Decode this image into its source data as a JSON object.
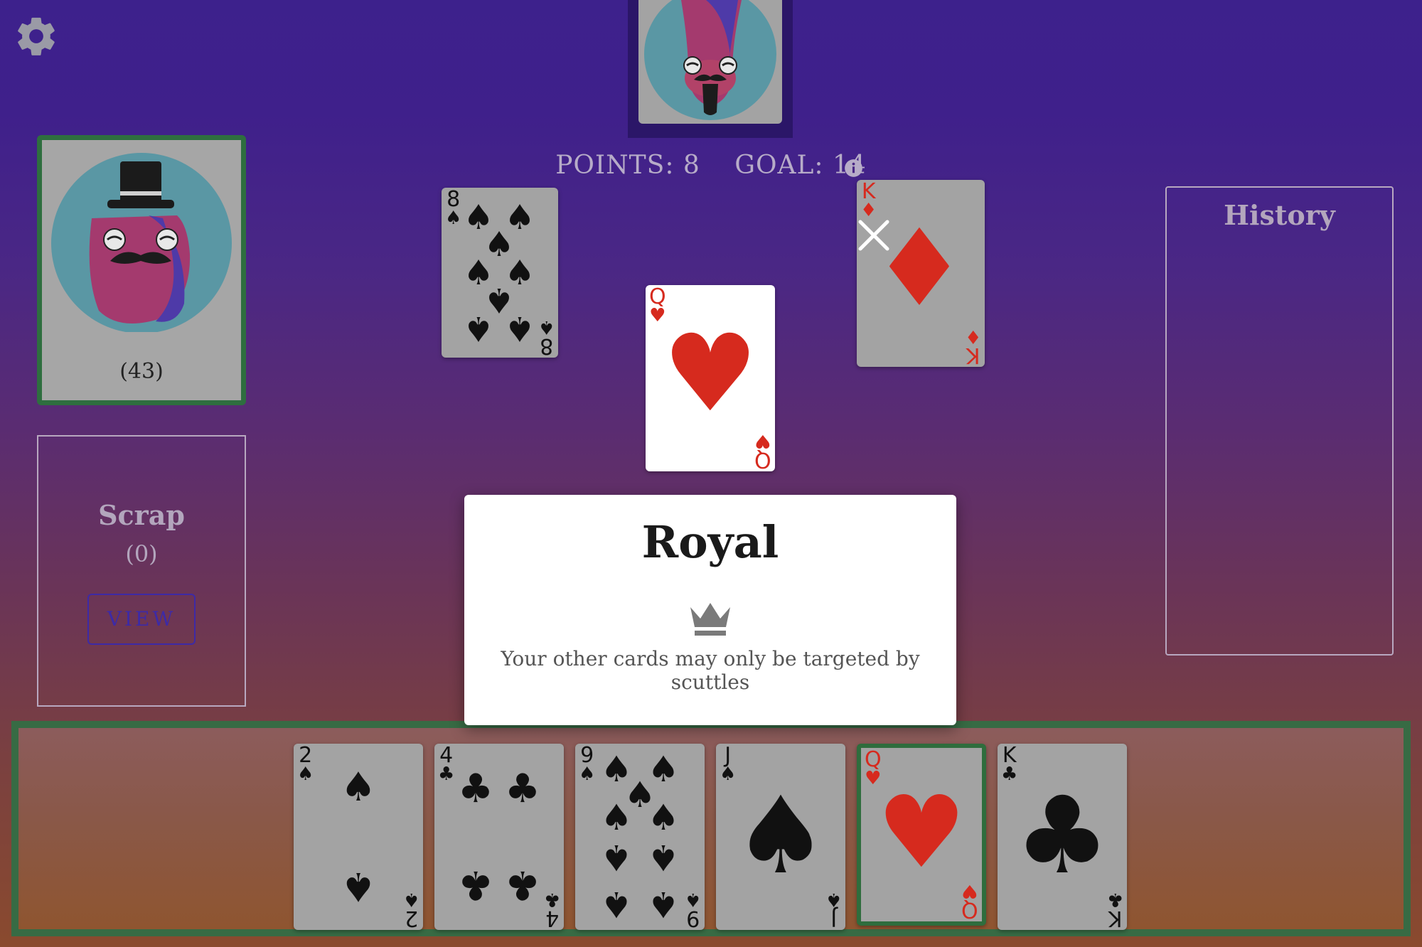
{
  "scoreboard": {
    "points_label": "POINTS: 8",
    "goal_label": "GOAL: 14"
  },
  "deck": {
    "count_label": "(43)"
  },
  "scrap": {
    "title": "Scrap",
    "count_label": "(0)",
    "view_label": "VIEW"
  },
  "history": {
    "title": "History"
  },
  "board": {
    "cards": [
      {
        "rank": "8",
        "suit": "♠",
        "color": "black"
      },
      {
        "rank": "Q",
        "suit": "♥",
        "color": "red"
      },
      {
        "rank": "K",
        "suit": "♦",
        "color": "red"
      }
    ]
  },
  "hand": {
    "cards": [
      {
        "rank": "2",
        "suit": "♠",
        "color": "black"
      },
      {
        "rank": "4",
        "suit": "♣",
        "color": "black"
      },
      {
        "rank": "9",
        "suit": "♠",
        "color": "black"
      },
      {
        "rank": "J",
        "suit": "♠",
        "color": "black"
      },
      {
        "rank": "Q",
        "suit": "♥",
        "color": "red",
        "selected": true
      },
      {
        "rank": "K",
        "suit": "♣",
        "color": "black"
      }
    ]
  },
  "modal": {
    "title": "Royal",
    "icon": "crown-icon",
    "description": "Your other cards may only be targeted by scuttles"
  },
  "icons": {
    "settings": "gear-icon",
    "info": "info-icon",
    "cancel": "close-icon"
  },
  "colors": {
    "background_top": "#3d218c",
    "background_bottom": "#8a4a2e",
    "frame_green": "#2e6e3f",
    "suit_red": "#d62a1e",
    "view_button": "#3d2aa6"
  }
}
